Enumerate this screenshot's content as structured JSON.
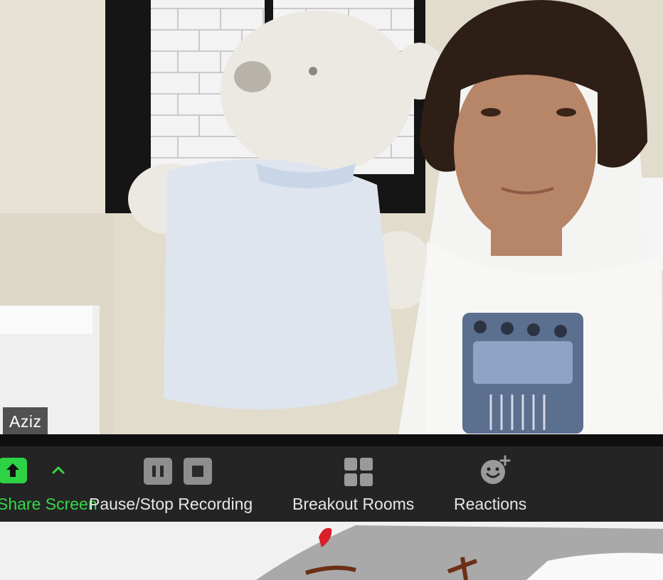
{
  "participant": {
    "name": "Aziz"
  },
  "toolbar": {
    "share_label": "Share Screen",
    "recording_label": "Pause/Stop Recording",
    "breakout_label": "Breakout Rooms",
    "reactions_label": "Reactions"
  },
  "icons": {
    "share": "share-arrow-up-icon",
    "share_options": "chevron-up-icon",
    "pause": "pause-icon",
    "stop": "stop-icon",
    "breakout": "grid-squares-icon",
    "reactions": "smiley-plus-icon"
  },
  "colors": {
    "toolbar_bg": "#242424",
    "share_green": "#2dd245",
    "label_text": "#e6e6e6",
    "recording_button": "#8e8e8e"
  }
}
